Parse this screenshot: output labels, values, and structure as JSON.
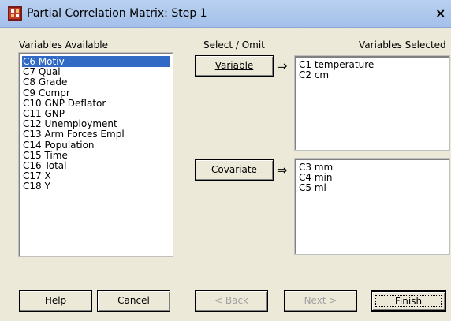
{
  "window": {
    "title": "Partial Correlation Matrix: Step 1",
    "close_glyph": "×"
  },
  "labels": {
    "variables_available": "Variables Available",
    "select_omit": "Select / Omit",
    "variables_selected": "Variables Selected"
  },
  "available": [
    "C6 Motiv",
    "C7 Qual",
    "C8 Grade",
    "C9 Compr",
    "C10 GNP Deflator",
    "C11 GNP",
    "C12 Unemployment",
    "C13 Arm Forces Empl",
    "C14 Population",
    "C15 Time",
    "C16 Total",
    "C17 X",
    "C18 Y"
  ],
  "available_selected_index": 0,
  "variable_button": {
    "label": "Variable",
    "arrow": "⇒"
  },
  "covariate_button": {
    "label": "Covariate",
    "arrow": "⇒"
  },
  "selected_variables": [
    "C1 temperature",
    "C2 cm"
  ],
  "selected_covariates": [
    "C3 mm",
    "C4 min",
    "C5 ml"
  ],
  "footer": {
    "help": "Help",
    "cancel": "Cancel",
    "back": "< Back",
    "next": "Next >",
    "finish": "Finish"
  },
  "colors": {
    "selection": "#316ac5",
    "dialog": "#ece9d8"
  },
  "icons": {
    "app": "matrix-app-icon"
  }
}
